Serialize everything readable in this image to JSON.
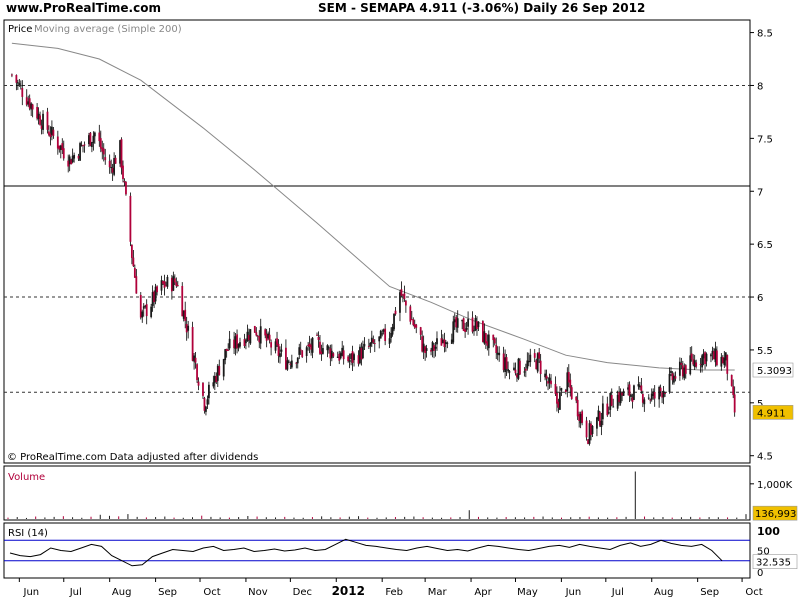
{
  "header": {
    "site": "www.ProRealTime.com",
    "title": "SEM - SEMAPA    4.911 (-3.06%)    Daily  26 Sep 2012"
  },
  "panels": {
    "price_label": "Price",
    "ma_label": "Moving average (Simple 200)",
    "copyright": "© ProRealTime.com  Data adjusted after dividends",
    "volume_label": "Volume",
    "rsi_label": "RSI (14)"
  },
  "colors": {
    "up": "#1a1a1a",
    "down": "#b0003a",
    "ma": "#888888",
    "rsi_band": "#0000cc",
    "rsi_line": "#000000",
    "price_tag": "#f0c000",
    "volume_label": "#b0003a"
  },
  "chart_data": [
    {
      "type": "line",
      "series": [
        {
          "name": "Price",
          "x": [
            "2011-05-27",
            "2011-06-17",
            "2011-07-05",
            "2011-07-22",
            "2011-08-01",
            "2011-08-08",
            "2011-08-16",
            "2011-08-22",
            "2011-09-05",
            "2011-09-15",
            "2011-10-04",
            "2011-10-19",
            "2011-11-07",
            "2011-11-28",
            "2011-12-19",
            "2012-01-10",
            "2012-02-06",
            "2012-02-13",
            "2012-03-02",
            "2012-03-20",
            "2012-04-03",
            "2012-04-27",
            "2012-05-16",
            "2012-05-29",
            "2012-06-05",
            "2012-06-19",
            "2012-07-06",
            "2012-07-20",
            "2012-08-03",
            "2012-08-13",
            "2012-08-20",
            "2012-09-05",
            "2012-09-20",
            "2012-09-26"
          ],
          "values": [
            8.1,
            7.65,
            7.3,
            7.55,
            7.2,
            7.4,
            6.4,
            5.8,
            6.1,
            6.15,
            5.0,
            5.5,
            5.7,
            5.4,
            5.55,
            5.4,
            5.65,
            6.05,
            5.45,
            5.7,
            5.75,
            5.3,
            5.4,
            5.0,
            5.2,
            4.7,
            5.05,
            5.1,
            5.05,
            5.2,
            5.3,
            5.45,
            5.4,
            4.91
          ]
        },
        {
          "name": "Moving average (Simple 200)",
          "x": [
            "2011-05-27",
            "2011-06-27",
            "2011-07-25",
            "2011-08-22",
            "2011-10-03",
            "2011-11-07",
            "2011-12-19",
            "2012-02-06",
            "2012-03-05",
            "2012-04-02",
            "2012-05-07",
            "2012-06-04",
            "2012-07-02",
            "2012-08-06",
            "2012-09-03",
            "2012-09-26"
          ],
          "values": [
            8.4,
            8.35,
            8.25,
            8.05,
            7.6,
            7.2,
            6.7,
            6.1,
            5.95,
            5.78,
            5.6,
            5.45,
            5.38,
            5.33,
            5.31,
            5.31
          ]
        }
      ],
      "y_ticks": [
        8.5,
        8,
        7.5,
        7,
        6.5,
        6,
        5.5,
        5,
        4.5
      ],
      "y_tick_labels": [
        "8.5",
        "8",
        "7.5",
        "7",
        "6.5",
        "6",
        "5.5",
        "5",
        "4.5"
      ],
      "ylim": [
        4.45,
        8.6
      ],
      "dashed_levels": [
        8,
        6,
        5.1
      ],
      "solid_levels": [
        7.05
      ],
      "ma_last_label": "5.3093",
      "last_price_label": "4.911"
    },
    {
      "type": "bar",
      "series": [
        {
          "name": "Volume",
          "values": [
            40,
            55,
            30,
            70,
            45,
            60,
            80,
            50,
            35,
            65,
            120,
            90,
            75,
            140,
            60,
            45,
            55,
            70,
            40,
            35,
            50,
            95,
            60,
            45,
            40,
            55,
            85,
            70,
            50,
            45,
            60,
            40,
            35,
            55,
            75,
            50,
            45,
            65,
            80,
            40,
            35,
            45,
            55,
            60,
            70,
            50,
            40,
            35,
            45,
            55,
            250,
            60,
            45,
            40,
            55,
            50,
            45,
            60,
            70,
            45,
            40,
            50,
            55,
            65,
            45,
            40,
            50,
            60,
            1350,
            70,
            45,
            55,
            40,
            50,
            60,
            45,
            55,
            50,
            45,
            40,
            137
          ]
        }
      ],
      "y_tick_labels": [
        "1,000K"
      ],
      "ylim": [
        0,
        1450
      ],
      "last_value_label": "136,993"
    },
    {
      "type": "line",
      "series": [
        {
          "name": "RSI (14)",
          "values": [
            45,
            40,
            38,
            42,
            55,
            50,
            48,
            55,
            62,
            58,
            40,
            30,
            20,
            22,
            38,
            45,
            52,
            50,
            48,
            55,
            58,
            50,
            52,
            55,
            48,
            50,
            53,
            49,
            51,
            55,
            50,
            52,
            62,
            72,
            66,
            60,
            58,
            55,
            52,
            50,
            55,
            58,
            54,
            50,
            52,
            49,
            55,
            60,
            58,
            55,
            52,
            50,
            54,
            58,
            60,
            56,
            62,
            58,
            55,
            52,
            60,
            65,
            58,
            62,
            70,
            64,
            60,
            58,
            62,
            50,
            30
          ]
        }
      ],
      "y_tick_labels": [
        "100",
        "50",
        "0"
      ],
      "ylim": [
        0,
        100
      ],
      "bands": [
        70,
        30
      ],
      "last_value_label": "32.535"
    }
  ],
  "x_axis": {
    "labels": [
      "Jun",
      "Jul",
      "Aug",
      "Sep",
      "Oct",
      "Nov",
      "Dec",
      "2012",
      "Feb",
      "Mar",
      "Apr",
      "May",
      "Jun",
      "Jul",
      "Aug",
      "Sep",
      "Oct"
    ]
  }
}
